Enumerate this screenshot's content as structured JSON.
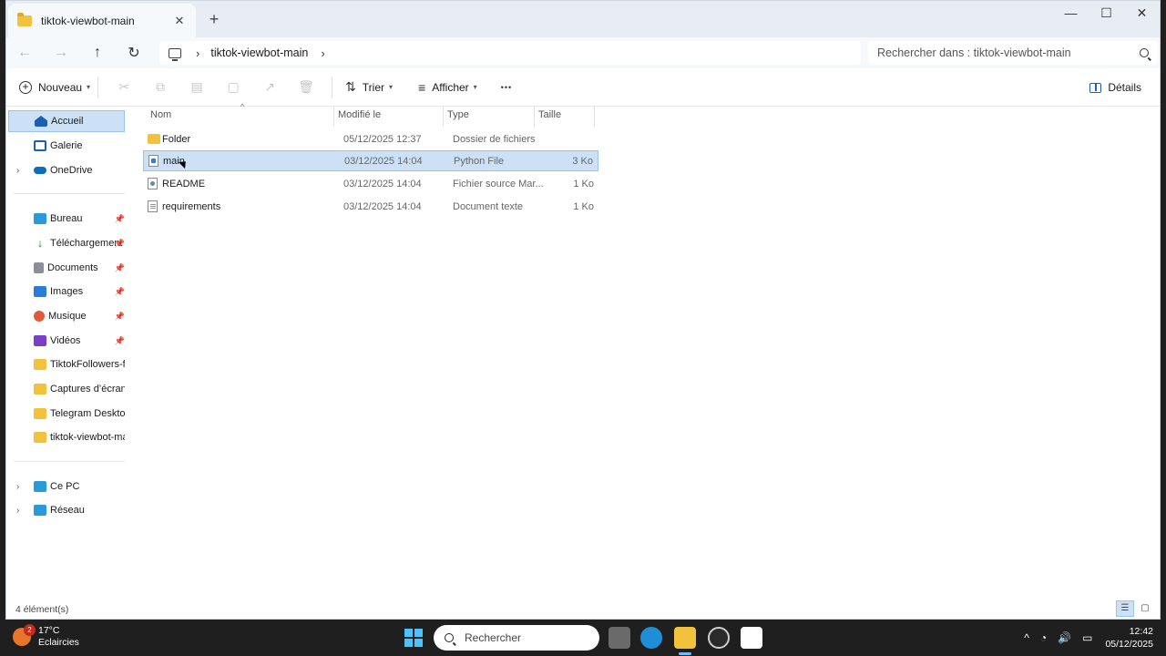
{
  "window": {
    "tab_title": "tiktok-viewbot-main",
    "tab_close_glyph": "✕",
    "new_tab_glyph": "+",
    "controls": {
      "minimize": "—",
      "maximize": "☐",
      "close": "✕"
    }
  },
  "nav": {
    "back_glyph": "←",
    "forward_glyph": "→",
    "up_glyph": "↑",
    "refresh_glyph": "↻",
    "breadcrumb": [
      "tiktok-viewbot-main"
    ],
    "search_placeholder": "Rechercher dans : tiktok-viewbot-main"
  },
  "commands": {
    "new_label": "Nouveau",
    "sort_label": "Trier",
    "view_label": "Afficher",
    "more_glyph": "•••",
    "details_label": "Détails"
  },
  "sidebar": {
    "items": [
      {
        "label": "Accueil",
        "icon": "home-icon",
        "color": "#1a5fb4"
      },
      {
        "label": "Galerie",
        "icon": "gallery-icon",
        "color": "#1a5fb4"
      },
      {
        "label": "OneDrive",
        "icon": "onedrive-icon",
        "color": "#0f6cbd"
      },
      {
        "label": "Bureau",
        "icon": "desktop-icon",
        "color": "#2b9ad9"
      },
      {
        "label": "Téléchargement",
        "icon": "download-icon",
        "color": "#2a8c3a"
      },
      {
        "label": "Documents",
        "icon": "documents-icon",
        "color": "#8a8f99"
      },
      {
        "label": "Images",
        "icon": "images-icon",
        "color": "#2b7dd6"
      },
      {
        "label": "Musique",
        "icon": "music-icon",
        "color": "#e35a39"
      },
      {
        "label": "Vidéos",
        "icon": "videos-icon",
        "color": "#7a3fc4"
      },
      {
        "label": "TiktokFollowers-fas",
        "icon": "folder-icon",
        "color": "#f3c23d"
      },
      {
        "label": "Captures d’écran",
        "icon": "folder-icon",
        "color": "#f3c23d"
      },
      {
        "label": "Telegram Desktop",
        "icon": "folder-icon",
        "color": "#f3c23d"
      },
      {
        "label": "tiktok-viewbot-mai",
        "icon": "folder-icon",
        "color": "#f3c23d"
      },
      {
        "label": "Ce PC",
        "icon": "pc-icon",
        "color": "#2b9ad9"
      },
      {
        "label": "Réseau",
        "icon": "network-icon",
        "color": "#2b9ad9"
      }
    ]
  },
  "files": {
    "columns": {
      "name": "Nom",
      "modified": "Modifié le",
      "type": "Type",
      "size": "Taille"
    },
    "rows": [
      {
        "name": "Folder",
        "modified": "05/12/2025 12:37",
        "type": "Dossier de fichiers",
        "size": "",
        "icon": "folder-icon"
      },
      {
        "name": "main",
        "modified": "03/12/2025 14:04",
        "type": "Python File",
        "size": "3 Ko",
        "icon": "python-file-icon"
      },
      {
        "name": "README",
        "modified": "03/12/2025 14:04",
        "type": "Fichier source Mar...",
        "size": "1 Ko",
        "icon": "markdown-file-icon"
      },
      {
        "name": "requirements",
        "modified": "03/12/2025 14:04",
        "type": "Document texte",
        "size": "1 Ko",
        "icon": "text-file-icon"
      }
    ]
  },
  "status": {
    "count": "4 élément(s)"
  },
  "taskbar": {
    "weather_badge": "2",
    "temperature": "17°C",
    "condition": "Eclaircies",
    "search_placeholder": "Rechercher",
    "time": "12:42",
    "date": "05/12/2025"
  }
}
